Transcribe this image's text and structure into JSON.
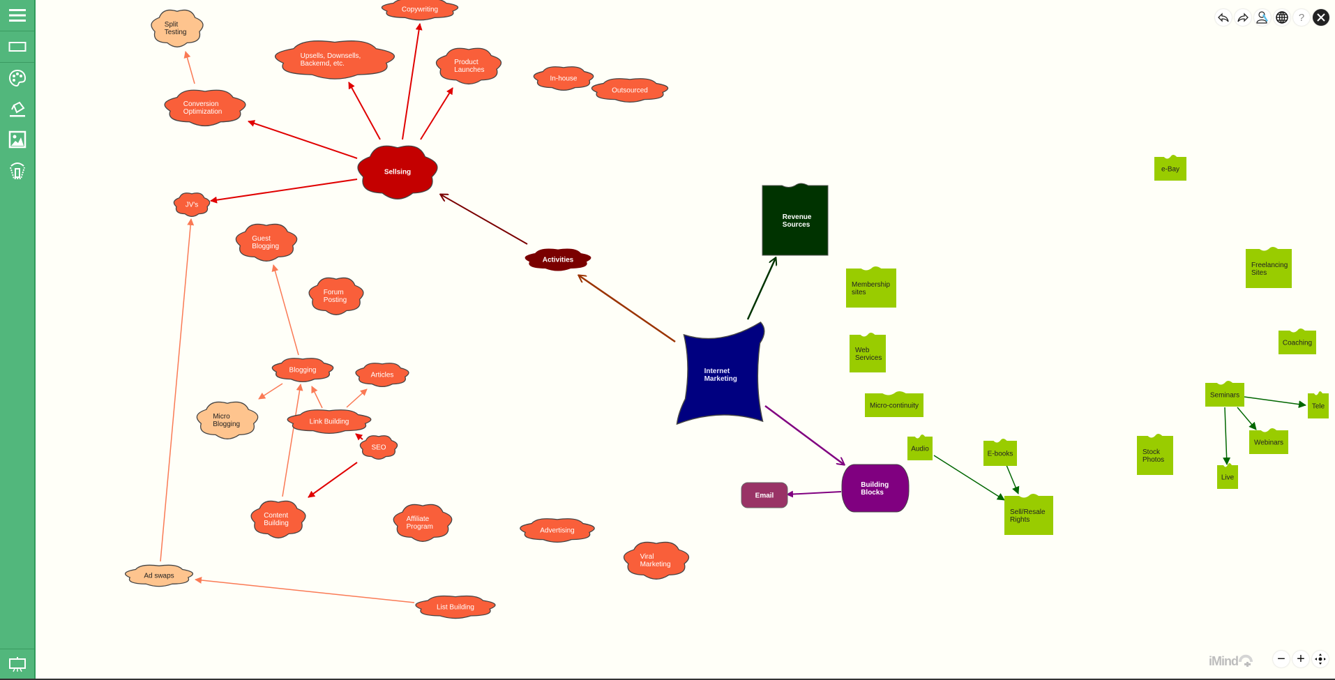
{
  "app": {
    "brand": "iMind"
  },
  "sidebar": {
    "items": [
      {
        "name": "menu",
        "icon": "hamburger-menu-icon"
      },
      {
        "name": "shape",
        "icon": "rectangle-icon"
      },
      {
        "name": "colors",
        "icon": "palette-icon"
      },
      {
        "name": "fill",
        "icon": "paint-bucket-icon"
      },
      {
        "name": "image",
        "icon": "image-icon"
      },
      {
        "name": "delete",
        "icon": "trash-icon"
      }
    ],
    "bottom": {
      "name": "presentation",
      "icon": "presentation-icon"
    }
  },
  "toolbar": {
    "buttons": [
      {
        "name": "undo",
        "icon": "undo-icon"
      },
      {
        "name": "redo",
        "icon": "redo-icon"
      },
      {
        "name": "share",
        "icon": "user-share-icon"
      },
      {
        "name": "language",
        "icon": "globe-icon"
      },
      {
        "name": "help",
        "icon": "help-icon",
        "glyph": "?"
      },
      {
        "name": "close",
        "icon": "close-icon"
      }
    ]
  },
  "zoom_controls": {
    "out_glyph": "−",
    "in_glyph": "+",
    "fit": "fit-icon"
  },
  "colors": {
    "sidebar": "#52b77c",
    "cloud_orange": "#f95f3a",
    "cloud_peach": "#fec48e",
    "selling": "#c40000",
    "activities": "#7a0000",
    "root": "#000080",
    "revenue": "#003300",
    "building_blocks": "#800080",
    "email": "#993366",
    "lime": "#99cc00",
    "arrow_red": "#e00000",
    "arrow_light": "#fa7a55",
    "arrow_green": "#006600"
  },
  "nodes": [
    {
      "id": "internet-marketing",
      "lines": [
        "Internet",
        "Marketing"
      ]
    },
    {
      "id": "activities",
      "lines": [
        "Activities"
      ]
    },
    {
      "id": "sellsing",
      "lines": [
        "Sellsing"
      ]
    },
    {
      "id": "revenue-sources",
      "lines": [
        "Revenue",
        "Sources"
      ]
    },
    {
      "id": "building-blocks",
      "lines": [
        "Building",
        "Blocks"
      ]
    },
    {
      "id": "email",
      "lines": [
        "Email"
      ]
    },
    {
      "id": "split-testing",
      "lines": [
        "Split",
        "Testing"
      ]
    },
    {
      "id": "copywriting",
      "lines": [
        "Copywriting"
      ]
    },
    {
      "id": "upsells",
      "lines": [
        "Upsells, Downsells,",
        "Backemd, etc."
      ]
    },
    {
      "id": "product-launches",
      "lines": [
        "Product",
        "Launches"
      ]
    },
    {
      "id": "conversion-optimization",
      "lines": [
        "Conversion",
        "Optimization"
      ]
    },
    {
      "id": "in-house",
      "lines": [
        "In-house"
      ]
    },
    {
      "id": "outsourced",
      "lines": [
        "Outsourced"
      ]
    },
    {
      "id": "jvs",
      "lines": [
        "JV's"
      ]
    },
    {
      "id": "guest-blogging",
      "lines": [
        "Guest",
        "Blogging"
      ]
    },
    {
      "id": "forum-posting",
      "lines": [
        "Forum",
        "Posting"
      ]
    },
    {
      "id": "blogging",
      "lines": [
        "Blogging"
      ]
    },
    {
      "id": "articles",
      "lines": [
        "Articles"
      ]
    },
    {
      "id": "micro-blogging",
      "lines": [
        "Micro",
        "Blogging"
      ]
    },
    {
      "id": "link-building",
      "lines": [
        "Link Building"
      ]
    },
    {
      "id": "seo",
      "lines": [
        "SEO"
      ]
    },
    {
      "id": "content-building",
      "lines": [
        "Content",
        "Building"
      ]
    },
    {
      "id": "affiliate-program",
      "lines": [
        "Affiliate",
        "Program"
      ]
    },
    {
      "id": "advertising",
      "lines": [
        "Advertising"
      ]
    },
    {
      "id": "viral-marketing",
      "lines": [
        "Viral",
        "Marketing"
      ]
    },
    {
      "id": "ad-swaps",
      "lines": [
        "Ad swaps"
      ]
    },
    {
      "id": "list-building",
      "lines": [
        "List Building"
      ]
    },
    {
      "id": "membership-sites",
      "lines": [
        "Membership",
        "sites"
      ]
    },
    {
      "id": "web-services",
      "lines": [
        "Web",
        "Services"
      ]
    },
    {
      "id": "micro-continuity",
      "lines": [
        "Micro-continuity"
      ]
    },
    {
      "id": "audio",
      "lines": [
        "Audio"
      ]
    },
    {
      "id": "e-books",
      "lines": [
        "E-books"
      ]
    },
    {
      "id": "sell-resale-rights",
      "lines": [
        "Sell/Resale",
        "Rights"
      ]
    },
    {
      "id": "stock-photos",
      "lines": [
        "Stock",
        "Photos"
      ]
    },
    {
      "id": "e-bay",
      "lines": [
        "e-Bay"
      ]
    },
    {
      "id": "freelancing-sites",
      "lines": [
        "Freelancing",
        "Sites"
      ]
    },
    {
      "id": "coaching",
      "lines": [
        "Coaching"
      ]
    },
    {
      "id": "seminars",
      "lines": [
        "Seminars"
      ]
    },
    {
      "id": "tele",
      "lines": [
        "Tele"
      ]
    },
    {
      "id": "webinars",
      "lines": [
        "Webinars"
      ]
    },
    {
      "id": "live",
      "lines": [
        "Live"
      ]
    }
  ],
  "edges": [
    {
      "from": "internet-marketing",
      "to": "activities"
    },
    {
      "from": "internet-marketing",
      "to": "revenue-sources"
    },
    {
      "from": "internet-marketing",
      "to": "building-blocks"
    },
    {
      "from": "activities",
      "to": "sellsing"
    },
    {
      "from": "sellsing",
      "to": "conversion-optimization"
    },
    {
      "from": "sellsing",
      "to": "upsells"
    },
    {
      "from": "sellsing",
      "to": "copywriting"
    },
    {
      "from": "sellsing",
      "to": "product-launches"
    },
    {
      "from": "sellsing",
      "to": "jvs"
    },
    {
      "from": "conversion-optimization",
      "to": "split-testing"
    },
    {
      "from": "ad-swaps",
      "to": "jvs"
    },
    {
      "from": "list-building",
      "to": "ad-swaps"
    },
    {
      "from": "blogging",
      "to": "guest-blogging"
    },
    {
      "from": "blogging",
      "to": "micro-blogging"
    },
    {
      "from": "link-building",
      "to": "blogging"
    },
    {
      "from": "link-building",
      "to": "articles"
    },
    {
      "from": "content-building",
      "to": "blogging"
    },
    {
      "from": "seo",
      "to": "link-building"
    },
    {
      "from": "seo",
      "to": "content-building"
    },
    {
      "from": "building-blocks",
      "to": "email"
    },
    {
      "from": "audio",
      "to": "sell-resale-rights"
    },
    {
      "from": "e-books",
      "to": "sell-resale-rights"
    },
    {
      "from": "seminars",
      "to": "tele"
    },
    {
      "from": "seminars",
      "to": "webinars"
    },
    {
      "from": "seminars",
      "to": "live"
    }
  ]
}
